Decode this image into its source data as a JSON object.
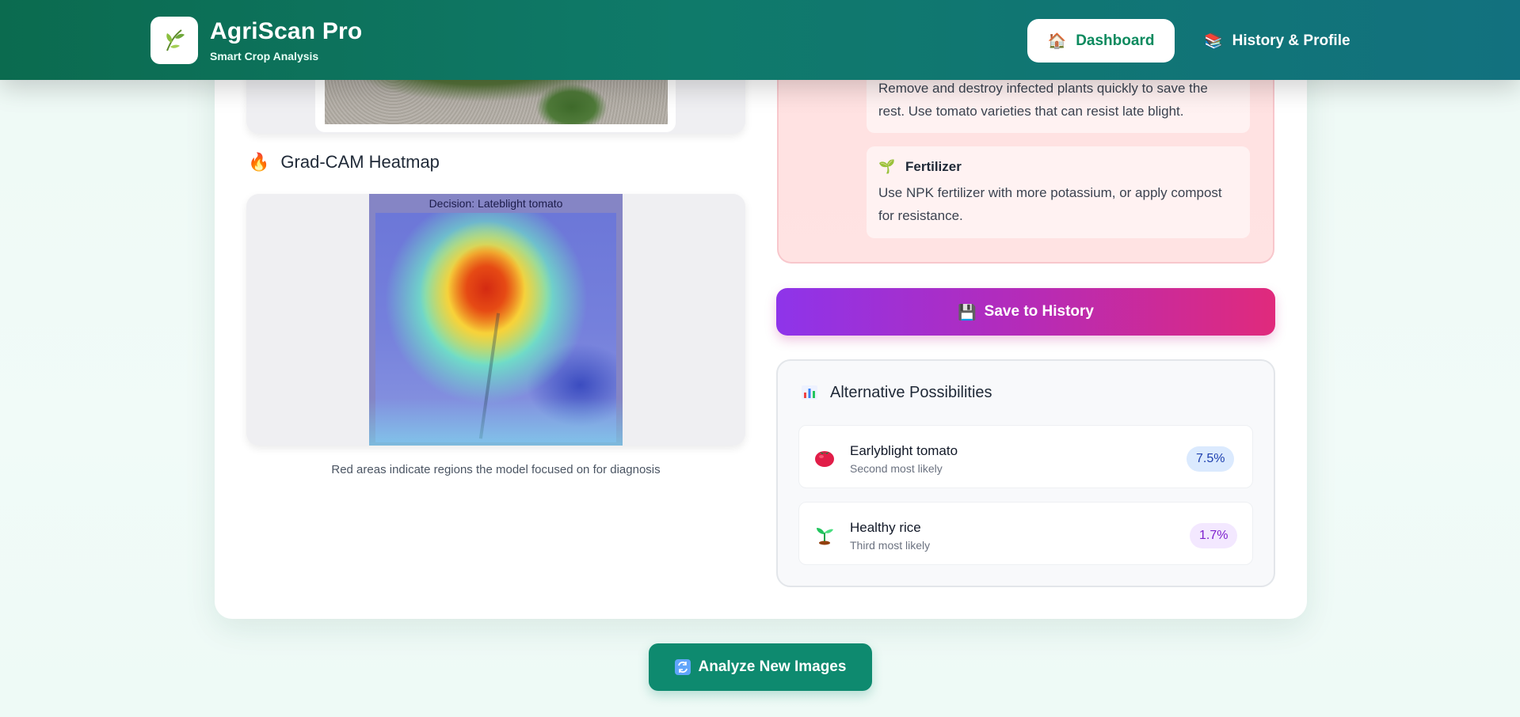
{
  "header": {
    "app_title": "AgriScan Pro",
    "app_subtitle": "Smart Crop Analysis",
    "nav": {
      "dashboard_label": "Dashboard",
      "history_label": "History & Profile"
    }
  },
  "left": {
    "heatmap_title": "Grad-CAM Heatmap",
    "heatmap_image_caption": "Decision: Lateblight tomato",
    "heatmap_description": "Red areas indicate regions the model focused on for diagnosis"
  },
  "treatment": {
    "management_text_line1": "Remove and destroy infected plants quickly to save the",
    "management_text_line2": "rest. Use tomato varieties that can resist late blight.",
    "fertilizer_title": "Fertilizer",
    "fertilizer_text_line1": "Use NPK fertilizer with more potassium, or apply compost",
    "fertilizer_text_line2": "for resistance."
  },
  "actions": {
    "save_label": "Save to History",
    "analyze_label": "Analyze New Images"
  },
  "alternatives": {
    "title": "Alternative Possibilities",
    "items": [
      {
        "name": "Earlyblight tomato",
        "note": "Second most likely",
        "percent": "7.5%",
        "icon": "tomato-icon",
        "badge_bg": "#dbeafe",
        "badge_color": "#1e40af"
      },
      {
        "name": "Healthy rice",
        "note": "Third most likely",
        "percent": "1.7%",
        "icon": "seedling-icon",
        "badge_bg": "#f3e8ff",
        "badge_color": "#7e22ce"
      }
    ]
  },
  "colors": {
    "header_start": "#0b6b4f",
    "header_end": "#12717f",
    "save_start": "#8e34ea",
    "save_end": "#e02a7c",
    "analyze_bg": "#0e8a6f"
  }
}
